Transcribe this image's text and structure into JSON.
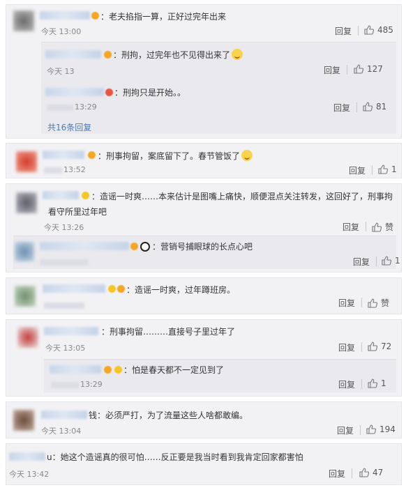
{
  "ui": {
    "reply_label": "回复",
    "like_label_zan": "赞"
  },
  "threads": [
    {
      "comment": {
        "text": "：老夫掐指一算，正好过完年出来",
        "time": "今天 13:00",
        "likes": "485"
      },
      "replies": [
        {
          "text": "：刑拘，过完年也不见得出来了",
          "time": "今天 13",
          "likes": "127"
        },
        {
          "text": "：刑拘只是开始。。",
          "time": "13:29",
          "likes": "81"
        }
      ],
      "more_replies": "共16条回复"
    },
    {
      "comment": {
        "text": "：刑事拘留，案底留下了。春节管饭了",
        "time": "13:52",
        "likes": "1"
      }
    },
    {
      "comment": {
        "text_line1": "：造谣一时爽……本来估计是图嘴上痛快，顺便混点关注转发，这回好了，刑事拘",
        "text_line2": "看守所里过年吧",
        "time": "今天 13:26",
        "likes": "赞"
      },
      "replies": [
        {
          "text": "：营销号捕眼球的长点心吧",
          "likes": "1"
        }
      ]
    },
    {
      "comment": {
        "text": "：造谣一时爽，过年蹲班房。",
        "likes": "赞"
      }
    },
    {
      "comment": {
        "text": "：刑事拘留………直接号子里过年了",
        "time": "今天 13:05",
        "likes": "72"
      },
      "replies": [
        {
          "text": "：怕是春天都不一定见到了",
          "time": "13:29",
          "likes": "1"
        }
      ]
    },
    {
      "comment": {
        "name_tail": "钱",
        "text": "：必须严打，为了流量这些人啥都敢编。",
        "time": "今天 13:04",
        "likes": "194"
      }
    },
    {
      "comment": {
        "name_tail": "u",
        "text": "：她这个造谣真的很可怕……反正要是我当时看到我肯定回家都害怕",
        "time": "今天 13:42",
        "likes": "47"
      }
    }
  ]
}
